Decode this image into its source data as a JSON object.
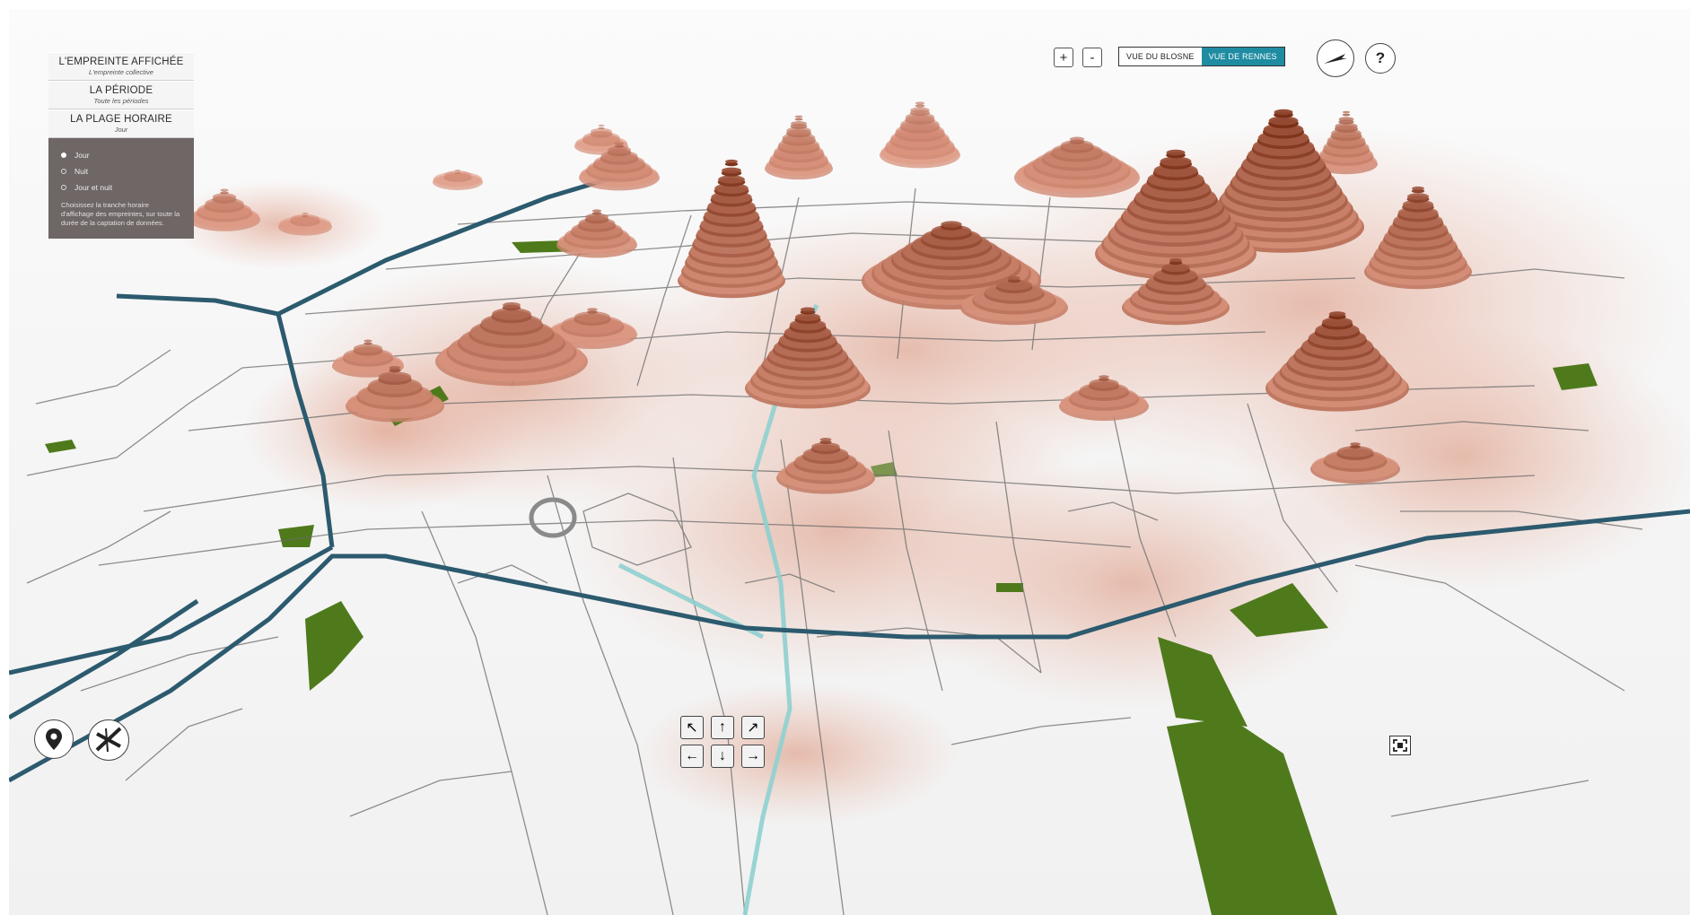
{
  "panel": {
    "sections": [
      {
        "title": "L'EMPREINTE AFFICHÉE",
        "subtitle": "L'empreinte collective"
      },
      {
        "title": "LA PÉRIODE",
        "subtitle": "Toute les périodes"
      },
      {
        "title": "LA PLAGE HORAIRE",
        "subtitle": "Jour"
      }
    ],
    "options": [
      {
        "label": "Jour",
        "selected": true
      },
      {
        "label": "Nuit",
        "selected": false
      },
      {
        "label": "Jour et nuit",
        "selected": false
      }
    ],
    "help_text": "Choisissez la tranche horaire d'affichage des empreintes, sur toute la durée de la captation de données."
  },
  "toolbar": {
    "zoom_in": "+",
    "zoom_out": "-",
    "view_blosne": "VUE DU BLOSNE",
    "view_rennes": "VUE DE RENNES",
    "active_view": "VUE DE RENNES",
    "help": "?"
  },
  "icons": {
    "compass": "compass-icon",
    "location": "location-pin-icon",
    "road": "road-icon",
    "fullscreen": "fullscreen-icon"
  },
  "navigation": {
    "arrows": [
      "↖",
      "↑",
      "↗",
      "←",
      "↓",
      "→"
    ]
  },
  "colors": {
    "accent": "#1f8ca2",
    "panel_bg": "#6f6666",
    "heat_peak": "#7a2e16",
    "heat_base": "#e9a48e",
    "highway": "#2c5a6e",
    "river": "#8fd0d0",
    "park": "#4f7a1c"
  }
}
